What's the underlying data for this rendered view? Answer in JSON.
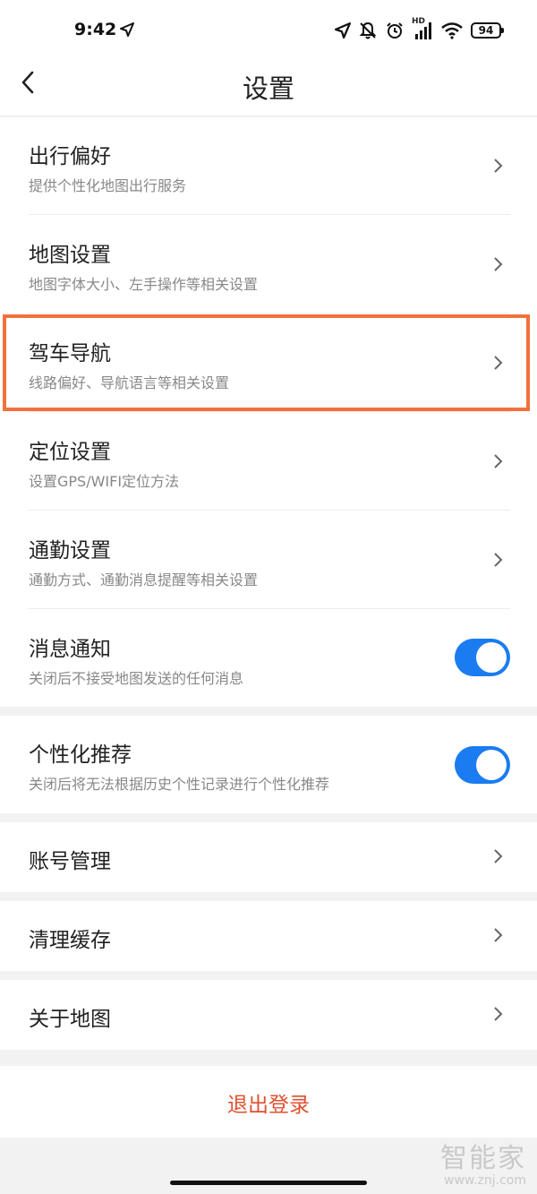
{
  "status_bar": {
    "time": "9:42",
    "battery": "94",
    "hd": "HD"
  },
  "header": {
    "title": "设置"
  },
  "settings": [
    {
      "label": "出行偏好",
      "desc": "提供个性化地图出行服务"
    },
    {
      "label": "地图设置",
      "desc": "地图字体大小、左手操作等相关设置"
    },
    {
      "label": "驾车导航",
      "desc": "线路偏好、导航语言等相关设置"
    },
    {
      "label": "定位设置",
      "desc": "设置GPS/WIFI定位方法"
    },
    {
      "label": "通勤设置",
      "desc": "通勤方式、通勤消息提醒等相关设置"
    },
    {
      "label": "消息通知",
      "desc": "关闭后不接受地图发送的任何消息",
      "toggle_on": true
    }
  ],
  "personalization": {
    "label": "个性化推荐",
    "desc": "关闭后将无法根据历史个性记录进行个性化推荐",
    "toggle_on": true
  },
  "account": {
    "label": "账号管理"
  },
  "cache": {
    "label": "清理缓存"
  },
  "about": {
    "label": "关于地图"
  },
  "logout": {
    "label": "退出登录"
  },
  "watermark": {
    "brand": "智能家",
    "url": "www.znj.com"
  },
  "colors": {
    "accent": "#1a7cf0",
    "highlight": "#f2703a",
    "danger": "#e0502f"
  },
  "icons": [
    "location-arrow-icon",
    "mute-bell-icon",
    "alarm-icon",
    "signal-icon",
    "wifi-icon",
    "battery-icon",
    "back-icon",
    "chevron-right-icon"
  ]
}
